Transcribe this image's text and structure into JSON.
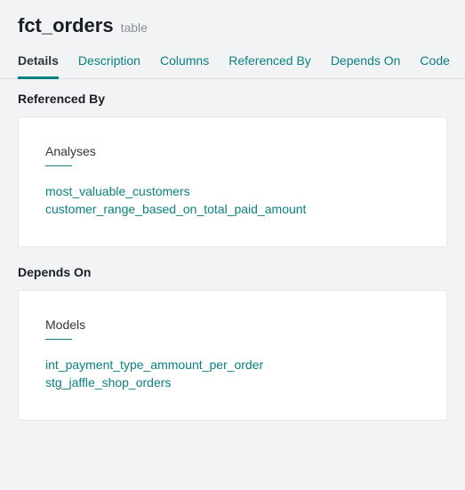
{
  "header": {
    "title": "fct_orders",
    "subtitle": "table"
  },
  "tabs": [
    {
      "label": "Details",
      "active": true
    },
    {
      "label": "Description",
      "active": false
    },
    {
      "label": "Columns",
      "active": false
    },
    {
      "label": "Referenced By",
      "active": false
    },
    {
      "label": "Depends On",
      "active": false
    },
    {
      "label": "Code",
      "active": false
    }
  ],
  "sections": {
    "referenced_by": {
      "title": "Referenced By",
      "group_title": "Analyses",
      "items": [
        "most_valuable_customers",
        "customer_range_based_on_total_paid_amount"
      ]
    },
    "depends_on": {
      "title": "Depends On",
      "group_title": "Models",
      "items": [
        "int_payment_type_ammount_per_order",
        "stg_jaffle_shop_orders"
      ]
    }
  }
}
